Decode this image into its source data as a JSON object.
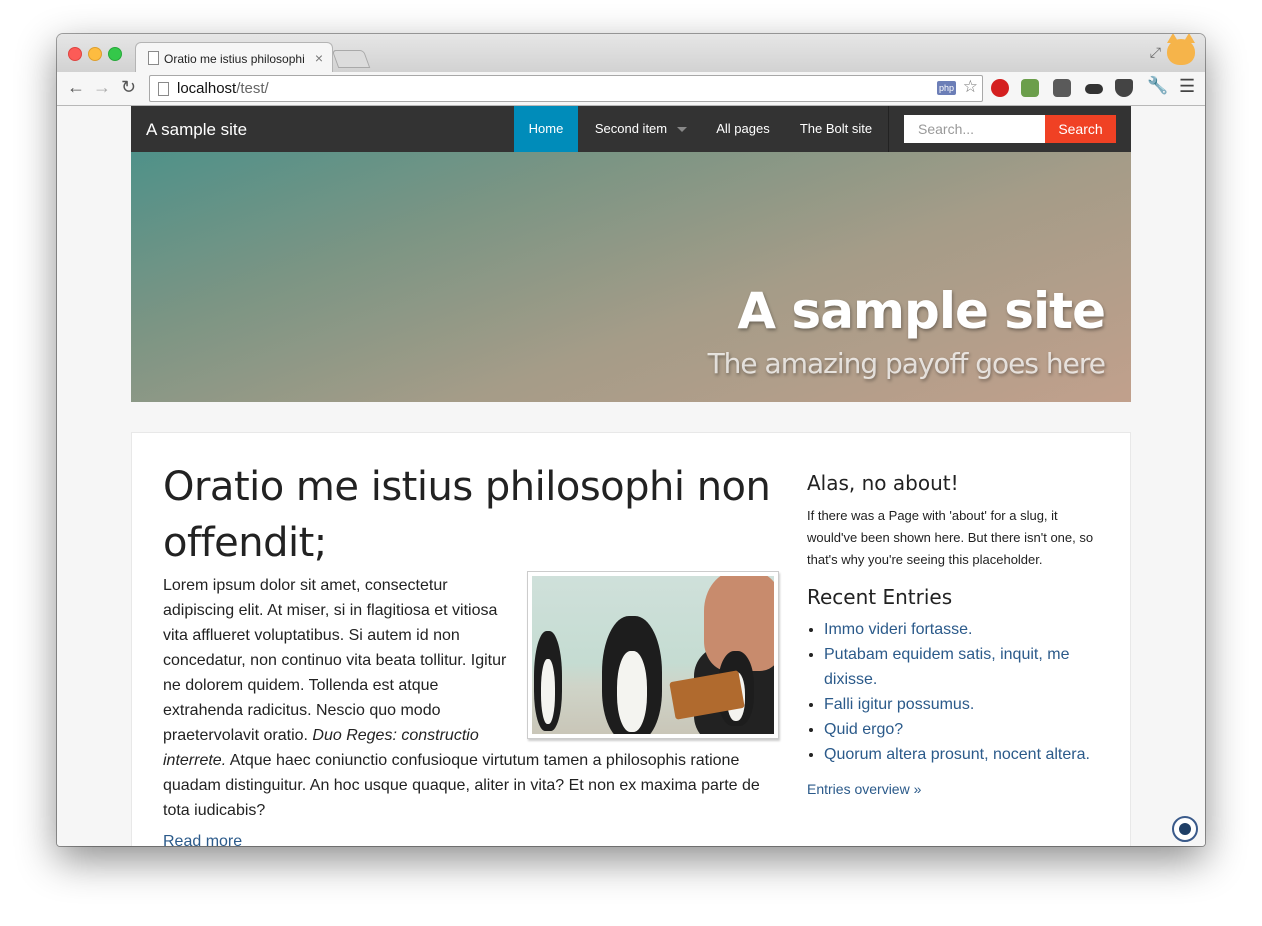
{
  "browser": {
    "tab_title": "Oratio me istius philosophi non offendit;",
    "tab_close": "×",
    "url_host": "localhost",
    "url_path": "/test/",
    "php_badge": "php"
  },
  "site": {
    "brand": "A sample site",
    "nav": {
      "home": "Home",
      "second": "Second item",
      "all_pages": "All pages",
      "bolt": "The Bolt site"
    },
    "search": {
      "placeholder": "Search...",
      "button": "Search"
    },
    "hero": {
      "title": "A sample site",
      "payoff": "The amazing payoff goes here"
    }
  },
  "article": {
    "title": "Oratio me istius philosophi non offendit;",
    "body_1": "Lorem ipsum dolor sit amet, consectetur adipiscing elit. At miser, si in flagitiosa et vitiosa vita afflueret voluptatibus. Si autem id non concedatur, non continuo vita beata tollitur. Igitur ne dolorem quidem. Tollenda est atque extrahenda radicitus. Nescio quo modo praetervolavit oratio. ",
    "body_em": "Duo Reges: constructio interrete.",
    "body_2": " Atque haec coniunctio confusioque virtutum tamen a philosophis ratione quadam distinguitur. An hoc usque quaque, aliter in vita? Et non ex maxima parte de tota iudicabis?",
    "read_more": "Read more"
  },
  "sidebar": {
    "about_heading": "Alas, no about!",
    "about_text": "If there was a Page with 'about' for a slug, it would've been shown here. But there isn't one, so that's why you're seeing this placeholder.",
    "recent_heading": "Recent Entries",
    "entries": [
      "Immo videri fortasse.",
      "Putabam equidem satis, inquit, me dixisse.",
      "Falli igitur possumus.",
      "Quid ergo?",
      "Quorum altera prosunt, nocent altera."
    ],
    "overview": "Entries overview »"
  },
  "colors": {
    "nav_bg": "#333333",
    "nav_active": "#008cba",
    "search_button": "#f04124",
    "link": "#2b5a8a"
  }
}
